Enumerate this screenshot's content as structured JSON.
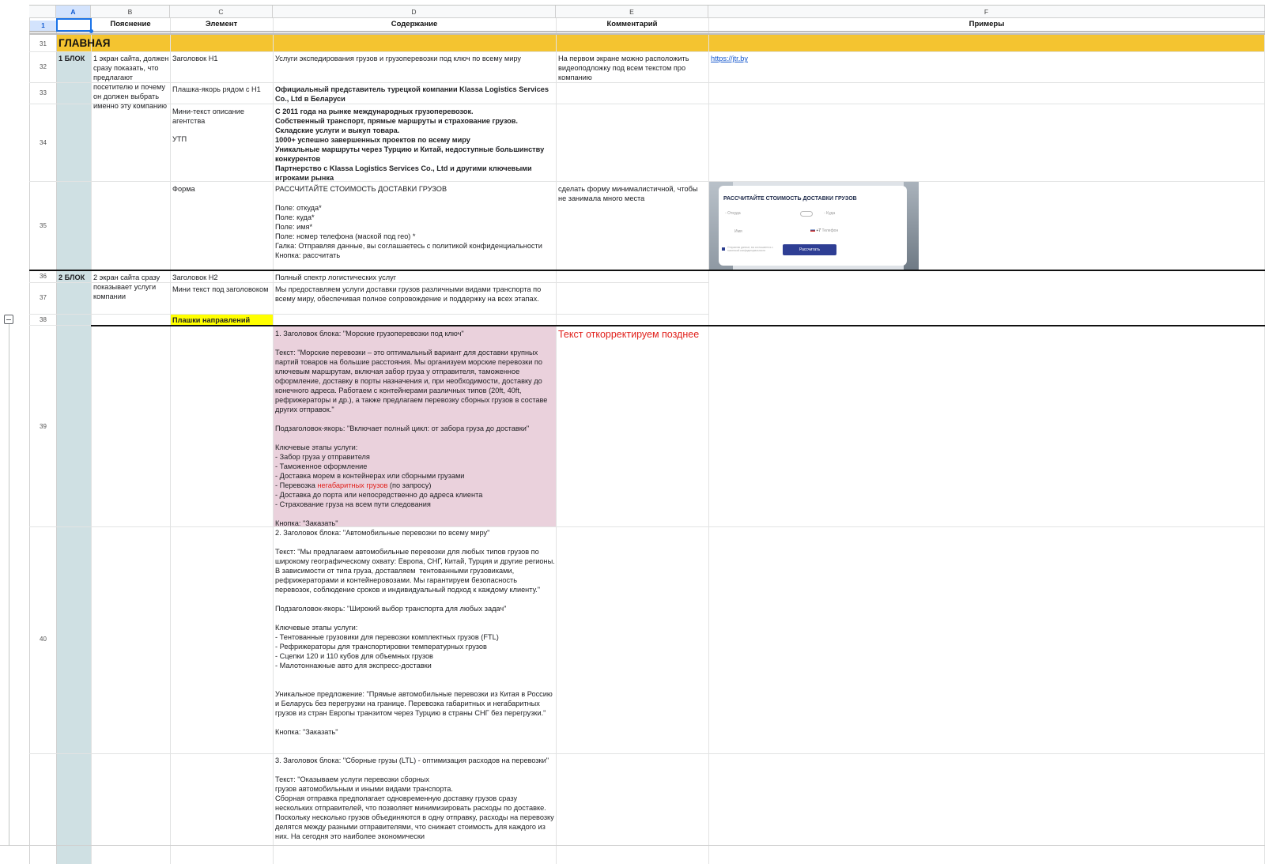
{
  "col_letters": [
    "A",
    "B",
    "C",
    "D",
    "E",
    "F"
  ],
  "header_row": {
    "num": "1",
    "b": "Пояснение",
    "c": "Элемент",
    "d": "Содержание",
    "e": "Комментарий",
    "f": "Примеры"
  },
  "row_numbers": [
    "31",
    "32",
    "33",
    "34",
    "35",
    "36",
    "37",
    "38",
    "39",
    "40"
  ],
  "section_title": "ГЛАВНАЯ",
  "block1": {
    "label": "1 БЛОК",
    "explanation": "1 экран сайта, должен сразу показать, что предлагают посетителю и почему он должен выбрать именно эту компанию",
    "r32": {
      "element": "Заголовок H1",
      "content": "Услуги экспедирования грузов и грузоперевозки под ключ по всему миру",
      "comment": "На первом экране можно расположить видеоподложку под всем текстом про компанию",
      "example": "https://jtr.by"
    },
    "r33": {
      "element": "Плашка-якорь рядом с H1",
      "content": "Официальный представитель турецкой компании Klassa Logistics Services Co., Ltd в Беларуси"
    },
    "r34": {
      "element1": "Мини-текст описание агентства",
      "element2": "УТП",
      "content": "С 2011 года на рынке международных грузоперевозок.\nСобственный транспорт, прямые маршруты и страхование грузов.\nСкладские услуги и выкуп товара.\n1000+ успешно завершенных проектов по всему миру\nУникальные маршруты через Турцию и Китай, недоступные большинству конкурентов\nПартнерство с Klassa Logistics Services Co., Ltd и другими ключевыми игроками рынка"
    },
    "r35": {
      "element": "Форма",
      "content": "РАССЧИТАЙТЕ СТОИМОСТЬ ДОСТАВКИ ГРУЗОВ\n\nПоле: откуда*\nПоле: куда*\nПоле: имя*\nПоле: номер телефона (маской под гео) *\nГалка: Отправляя данные, вы соглашаетесь с политикой конфиденциальности\nКнопка: рассчитать",
      "comment": "сделать форму минималистичной, чтобы не занимала много места",
      "preview": {
        "title": "РАССЧИТАЙТЕ СТОИМОСТЬ ДОСТАВКИ ГРУЗОВ",
        "from": "Откуда",
        "to": "Куда",
        "name": "Имя",
        "phone_prefix": "+7",
        "phone": "Телефон",
        "consent": "Отправляя данные, вы соглашаетесь с политикой конфиденциальности",
        "button": "Рассчитать"
      }
    }
  },
  "block2": {
    "label": "2 БЛОК",
    "explanation": "2 экран сайта сразу показывает услуги компании",
    "r36": {
      "element": "Заголовок H2",
      "content": "Полный спектр логистических услуг"
    },
    "r37": {
      "element": "Мини текст под заголовоком",
      "content": "Мы предоставляем услуги доставки грузов различными видами транспорта по всему миру, обеспечивая полное сопровождение и поддержку на всех этапах."
    },
    "r38": {
      "element": "Плашки направлений"
    },
    "r39": {
      "content_before": "1. Заголовок блока: \"Морские грузоперевозки под ключ\"\n\nТекст: \"Морские перевозки – это оптимальный вариант для доставки крупных партий товаров на большие расстояния. Мы организуем морские перевозки по ключевым маршрутам, включая забор груза у отправителя, таможенное оформление, доставку в порты назначения и, при необходимости, доставку до конечного адреса. Работаем с контейнерами различных типов (20ft, 40ft, рефрижераторы и др.), а также предлагаем перевозку сборных грузов в составе других отправок.\"\n\nПодзаголовок-якорь: \"Включает полный цикл: от забора груза до доставки\"\n\nКлючевые этапы услуги:\n- Забор груза у отправителя\n- Таможенное оформление\n- Доставка морем в контейнерах или сборными грузами\n- Перевозка ",
      "content_red": "негабаритных грузов",
      "content_after": " (по запросу)\n- Доставка до порта или непосредственно до адреса клиента\n- Страхование груза на всем пути следования\n\nКнопка: \"Заказать\"",
      "comment": "Текст откорректируем позднее"
    },
    "r40": {
      "content": "2. Заголовок блока: \"Автомобильные перевозки по всему миру\"\n\nТекст: \"Мы предлагаем автомобильные перевозки для любых типов грузов по широкому географическому охвату: Европа, СНГ, Китай, Турция и другие регионы. В зависимости от типа груза, доставляем  тентованными грузовиками, рефрижераторами и контейнеровозами. Мы гарантируем безопасность перевозок, соблюдение сроков и индивидуальный подход к каждому клиенту.\"\n\nПодзаголовок-якорь: \"Широкий выбор транспорта для любых задач\"\n\nКлючевые этапы услуги:\n- Тентованные грузовики для перевозки комплектных грузов (FTL)\n- Рефрижераторы для транспортировки температурных грузов\n- Сцепки 120 и 110 кубов для объемных грузов\n- Малотоннажные авто для экспресс-доставки\n\n\nУникальное предложение: \"Прямые автомобильные перевозки из Китая в Россию и Беларусь без перегрузки на границе. Перевозка габаритных и негабаритных грузов из стран Европы транзитом через Турцию в страны СНГ без перегрузки.\"\n\nКнопка: \"Заказать\""
    },
    "r41": {
      "content": "3. Заголовок блока: \"Сборные грузы (LTL) - оптимизация расходов на перевозки\"\n\nТекст: \"Оказываем услуги перевозки сборных\nгрузов автомобильным и иными видами транспорта.\nСборная отправка предполагает одновременную доставку грузов сразу нескольких отправителей, что позволяет минимизировать расходы по доставке. Поскольку несколько грузов объединяются в одну отправку, расходы на перевозку делятся между разными отправителями, что снижает стоимость для каждого из них. На сегодня это наиболее экономически"
    }
  },
  "colors": {
    "section_band": "#f4c430",
    "col_a_fill": "#cfe0e3",
    "pink_fill": "#ead1dc",
    "yellow_fill": "#ffff00",
    "red_text": "#e0201b",
    "selection": "#1a73e8"
  },
  "icons": [
    "group-collapse-icon"
  ]
}
